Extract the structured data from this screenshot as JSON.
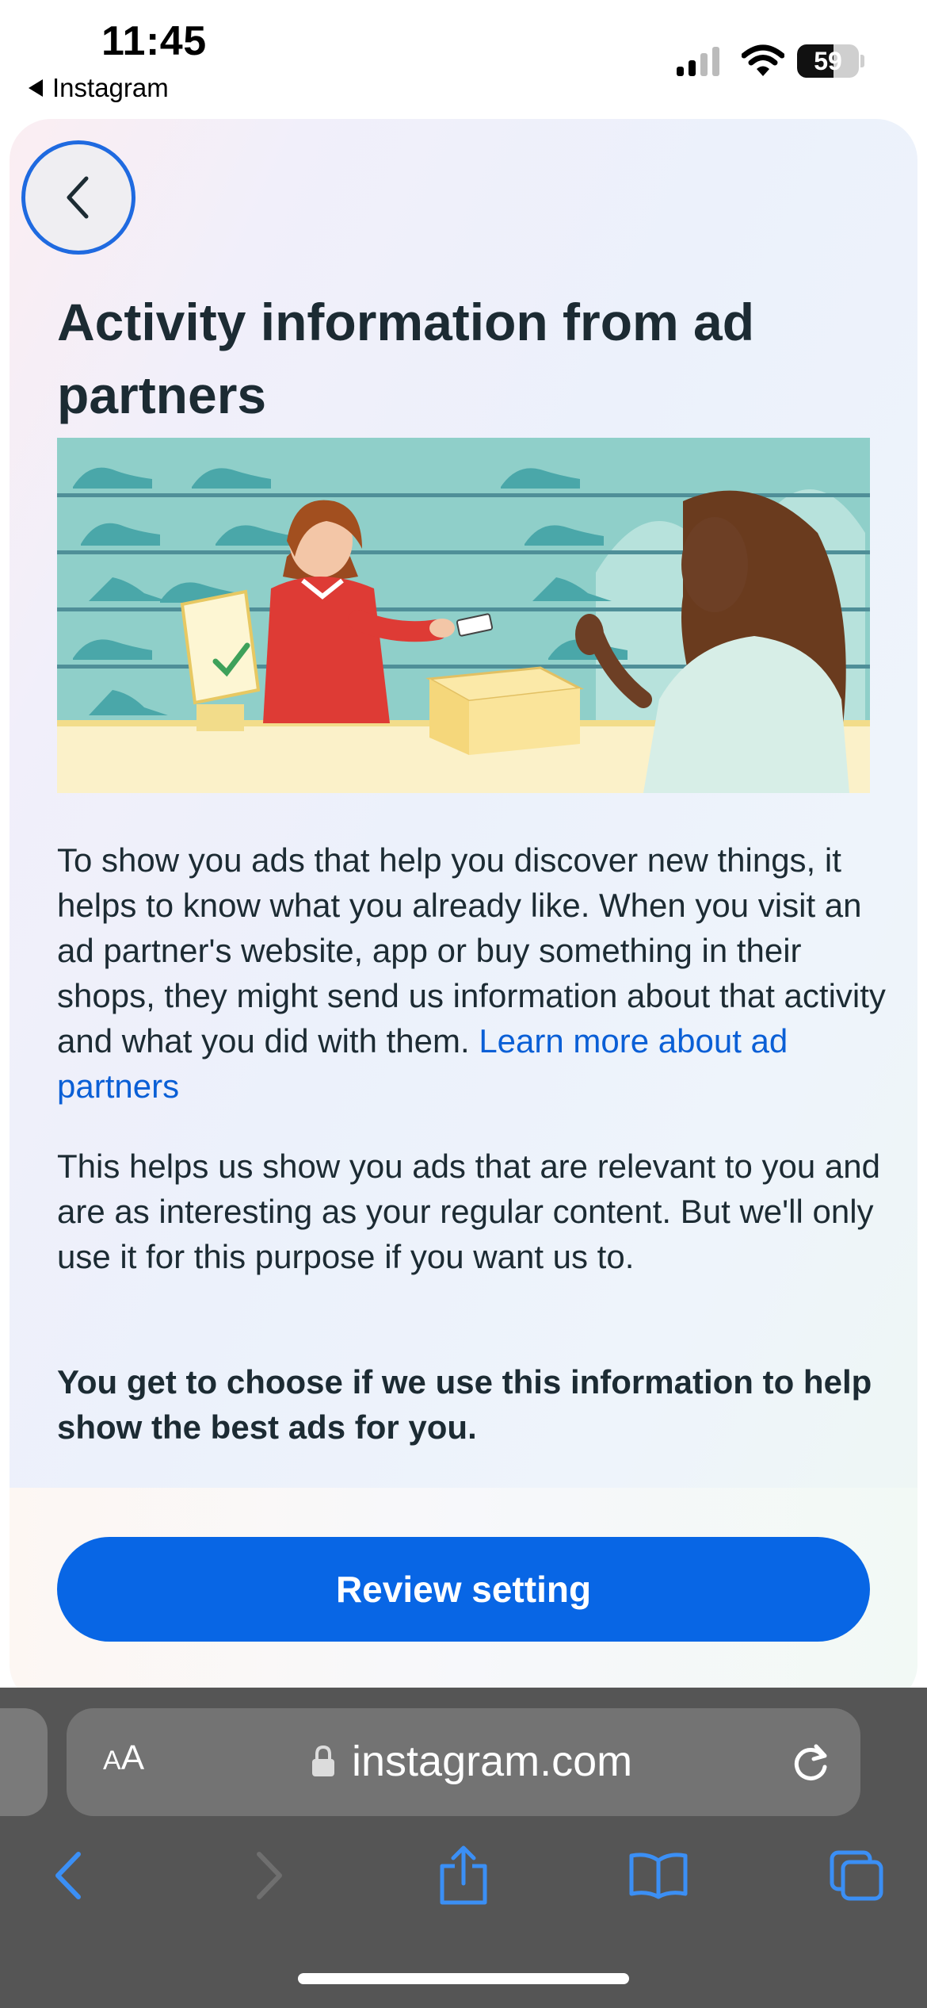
{
  "status_bar": {
    "time": "11:45",
    "back_app_label": "Instagram",
    "battery_level": "59",
    "icons": [
      "signal-icon",
      "wifi-icon",
      "battery-icon"
    ]
  },
  "page": {
    "title": "Activity information from ad partners",
    "paragraph1_text": "To show you ads that help you discover new things, it helps to know what you already like. When you visit an ad partner's website, app or buy something in their shops, they might send us information about that activity and what you did with them.",
    "paragraph1_link": "Learn more about ad partners",
    "paragraph2": "This helps us show you ads that are relevant to you and are as interesting as your regular content. But we'll only use it for this purpose if you want us to.",
    "paragraph3": "You get to choose if we use this information to help show the best ads for you.",
    "review_button": "Review setting"
  },
  "browser": {
    "aa_small": "A",
    "aa_large": "A",
    "url": "instagram.com"
  },
  "colors": {
    "primary_blue": "#0866e5",
    "link_blue": "#0a5fd6",
    "text_dark": "#1c2b33",
    "toolbar_blue": "#3b8ff5",
    "browser_gray": "#555555"
  }
}
